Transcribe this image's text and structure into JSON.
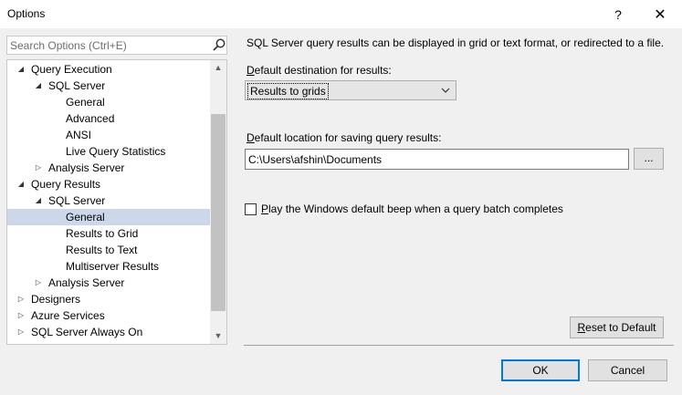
{
  "window": {
    "title": "Options",
    "help_label": "?",
    "close_label": "✕"
  },
  "search": {
    "placeholder": "Search Options (Ctrl+E)"
  },
  "tree": {
    "items": [
      {
        "label": "Query Execution",
        "level": 0,
        "arrow": "expanded",
        "selected": false
      },
      {
        "label": "SQL Server",
        "level": 1,
        "arrow": "expanded",
        "selected": false
      },
      {
        "label": "General",
        "level": 2,
        "arrow": "none",
        "selected": false
      },
      {
        "label": "Advanced",
        "level": 2,
        "arrow": "none",
        "selected": false
      },
      {
        "label": "ANSI",
        "level": 2,
        "arrow": "none",
        "selected": false
      },
      {
        "label": "Live Query Statistics",
        "level": 2,
        "arrow": "none",
        "selected": false
      },
      {
        "label": "Analysis Server",
        "level": 1,
        "arrow": "collapsed",
        "selected": false
      },
      {
        "label": "Query Results",
        "level": 0,
        "arrow": "expanded",
        "selected": false
      },
      {
        "label": "SQL Server",
        "level": 1,
        "arrow": "expanded",
        "selected": false
      },
      {
        "label": "General",
        "level": 2,
        "arrow": "none",
        "selected": true
      },
      {
        "label": "Results to Grid",
        "level": 2,
        "arrow": "none",
        "selected": false
      },
      {
        "label": "Results to Text",
        "level": 2,
        "arrow": "none",
        "selected": false
      },
      {
        "label": "Multiserver Results",
        "level": 2,
        "arrow": "none",
        "selected": false
      },
      {
        "label": "Analysis Server",
        "level": 1,
        "arrow": "collapsed",
        "selected": false
      },
      {
        "label": "Designers",
        "level": 0,
        "arrow": "collapsed",
        "selected": false
      },
      {
        "label": "Azure Services",
        "level": 0,
        "arrow": "collapsed",
        "selected": false
      },
      {
        "label": "SQL Server Always On",
        "level": 0,
        "arrow": "collapsed",
        "selected": false
      }
    ]
  },
  "content": {
    "description": "SQL Server query results can be displayed in grid or text format, or redirected to a file.",
    "destination_label": "Default destination for results:",
    "destination_value": "Results to grids",
    "location_label": "Default location for saving query results:",
    "location_value": "C:\\Users\\afshin\\Documents",
    "browse_label": "...",
    "beep_label": "Play the Windows default beep when a query batch completes",
    "beep_checked": false
  },
  "buttons": {
    "reset": "Reset to Default",
    "ok": "OK",
    "cancel": "Cancel"
  },
  "icons": {
    "search": "search-icon",
    "dropdown": "chevron-down-icon",
    "expanded": "triangle-down-right-icon",
    "collapsed": "triangle-right-icon",
    "scroll_up": "scroll-up-icon",
    "scroll_down": "scroll-down-icon"
  },
  "colors": {
    "selection": "#ccd7ea",
    "default_button_border": "#0078d7"
  }
}
